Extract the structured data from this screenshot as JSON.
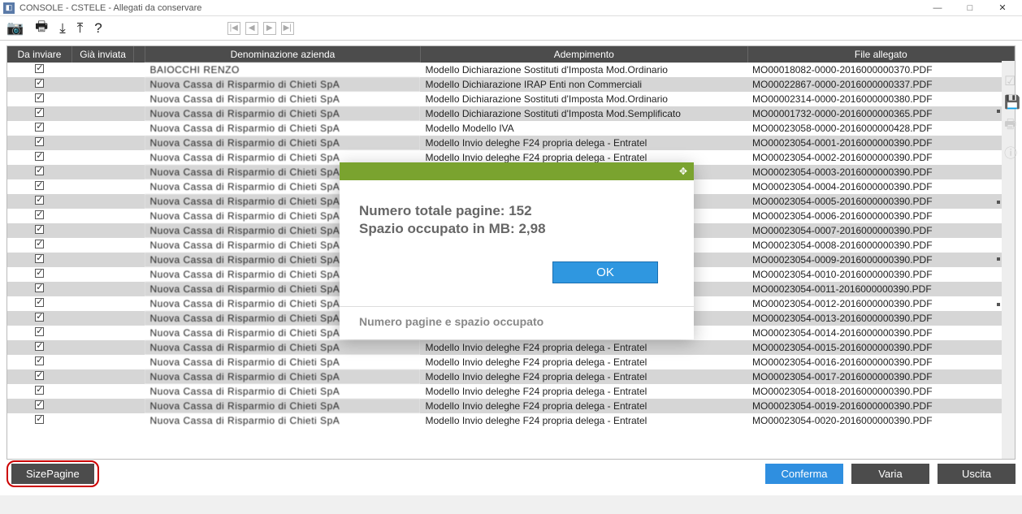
{
  "window": {
    "title": "CONSOLE  - CSTELE - Allegati da conservare",
    "minimize": "—",
    "maximize": "□",
    "close": "✕"
  },
  "toolbar": {
    "camera": "📷",
    "print": "🖶",
    "export": "⤓",
    "upload": "⤒",
    "help": "?",
    "nav_first": "|◀",
    "nav_prev": "◀",
    "nav_next": "▶",
    "nav_last": "▶|"
  },
  "columns": {
    "send": "Da inviare",
    "sent": "Già inviata",
    "denom": "Denominazione azienda",
    "ademp": "Adempimento",
    "file": "File allegato"
  },
  "rows": [
    {
      "denom": "BAIOCCHI RENZO",
      "ademp": "Modello Dichiarazione Sostituti d'Imposta Mod.Ordinario",
      "file": "MO00018082-0000-2016000000370.PDF"
    },
    {
      "denom": "",
      "ademp": "Modello Dichiarazione IRAP Enti non Commerciali",
      "file": "MO00022867-0000-2016000000337.PDF"
    },
    {
      "denom": "",
      "ademp": "Modello Dichiarazione Sostituti d'Imposta Mod.Ordinario",
      "file": "MO00002314-0000-2016000000380.PDF"
    },
    {
      "denom": "",
      "ademp": "Modello Dichiarazione Sostituti d'Imposta Mod.Semplificato",
      "file": "MO00001732-0000-2016000000365.PDF"
    },
    {
      "denom": "",
      "ademp": "Modello Modello IVA",
      "file": "MO00023058-0000-2016000000428.PDF"
    },
    {
      "denom": "",
      "ademp": "Modello Invio deleghe F24 propria delega - Entratel",
      "file": "MO00023054-0001-2016000000390.PDF"
    },
    {
      "denom": "",
      "ademp": "Modello Invio deleghe F24 propria delega - Entratel",
      "file": "MO00023054-0002-2016000000390.PDF"
    },
    {
      "denom": "",
      "ademp": "",
      "file": "MO00023054-0003-2016000000390.PDF"
    },
    {
      "denom": "",
      "ademp": "",
      "file": "MO00023054-0004-2016000000390.PDF"
    },
    {
      "denom": "",
      "ademp": "",
      "file": "MO00023054-0005-2016000000390.PDF"
    },
    {
      "denom": "",
      "ademp": "",
      "file": "MO00023054-0006-2016000000390.PDF"
    },
    {
      "denom": "",
      "ademp": "",
      "file": "MO00023054-0007-2016000000390.PDF"
    },
    {
      "denom": "",
      "ademp": "",
      "file": "MO00023054-0008-2016000000390.PDF"
    },
    {
      "denom": "",
      "ademp": "",
      "file": "MO00023054-0009-2016000000390.PDF"
    },
    {
      "denom": "",
      "ademp": "",
      "file": "MO00023054-0010-2016000000390.PDF"
    },
    {
      "denom": "",
      "ademp": "",
      "file": "MO00023054-0011-2016000000390.PDF"
    },
    {
      "denom": "",
      "ademp": "",
      "file": "MO00023054-0012-2016000000390.PDF"
    },
    {
      "denom": "",
      "ademp": "",
      "file": "MO00023054-0013-2016000000390.PDF"
    },
    {
      "denom": "",
      "ademp": "",
      "file": "MO00023054-0014-2016000000390.PDF"
    },
    {
      "denom": "",
      "ademp": "Modello Invio deleghe F24 propria delega - Entratel",
      "file": "MO00023054-0015-2016000000390.PDF"
    },
    {
      "denom": "",
      "ademp": "Modello Invio deleghe F24 propria delega - Entratel",
      "file": "MO00023054-0016-2016000000390.PDF"
    },
    {
      "denom": "",
      "ademp": "Modello Invio deleghe F24 propria delega - Entratel",
      "file": "MO00023054-0017-2016000000390.PDF"
    },
    {
      "denom": "",
      "ademp": "Modello Invio deleghe F24 propria delega - Entratel",
      "file": "MO00023054-0018-2016000000390.PDF"
    },
    {
      "denom": "",
      "ademp": "Modello Invio deleghe F24 propria delega - Entratel",
      "file": "MO00023054-0019-2016000000390.PDF"
    },
    {
      "denom": "",
      "ademp": "Modello Invio deleghe F24 propria delega - Entratel",
      "file": "MO00023054-0020-2016000000390.PDF"
    }
  ],
  "buttons": {
    "sizepagine": "SizePagine",
    "conferma": "Conferma",
    "varia": "Varia",
    "uscita": "Uscita"
  },
  "modal": {
    "line1_label": "Numero totale pagine: ",
    "line1_value": "152",
    "line2_label": "Spazio occupato in MB: ",
    "line2_value": "2,98",
    "ok": "OK",
    "footer": "Numero pagine e spazio occupato",
    "expand": "✥"
  },
  "side": {
    "check": "☑",
    "save": "💾",
    "print": "🖶",
    "info": "ⓘ"
  }
}
